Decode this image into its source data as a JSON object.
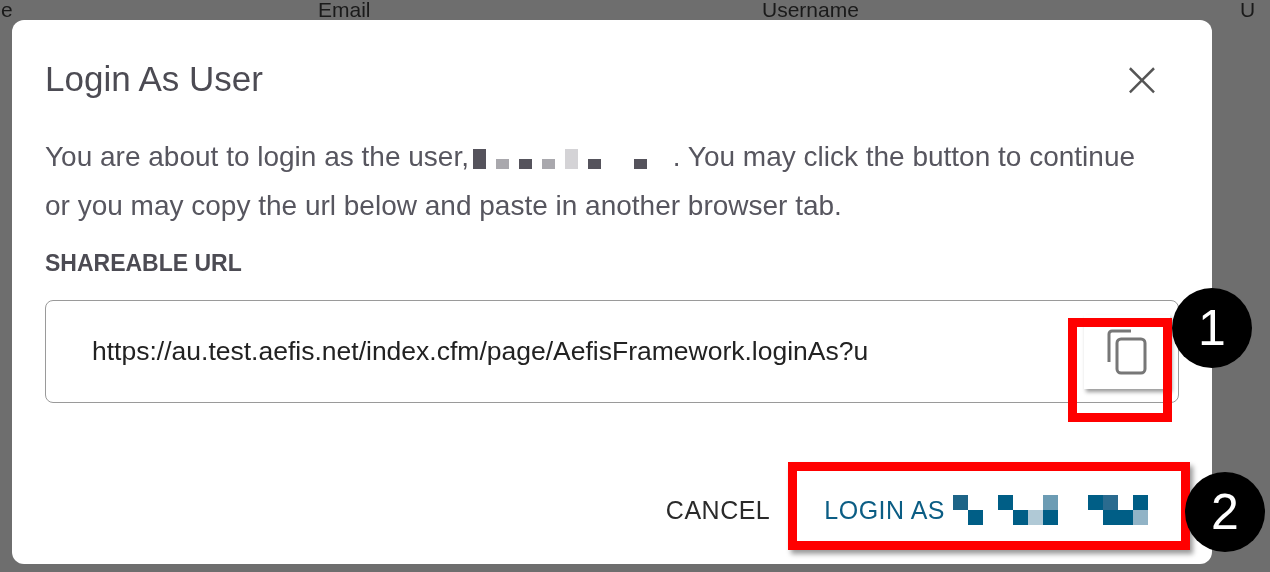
{
  "background_table": {
    "columns": [
      "e",
      "Email",
      "Username",
      "U"
    ]
  },
  "dialog": {
    "title": "Login As User",
    "close_icon": "×",
    "message_before": "You are about to login as the user,",
    "message_after": ". You may click the button to continue or you may copy the url below and paste in another browser tab.",
    "field_label": "SHAREABLE URL",
    "url": "https://au.test.aefis.net/index.cfm/page/AefisFramework.loginAs?u",
    "buttons": [
      {
        "label": "CANCEL",
        "kind": "text"
      },
      {
        "label": "LOGIN AS",
        "kind": "primary"
      }
    ]
  },
  "annotations": [
    {
      "number": "1"
    },
    {
      "number": "2"
    }
  ]
}
